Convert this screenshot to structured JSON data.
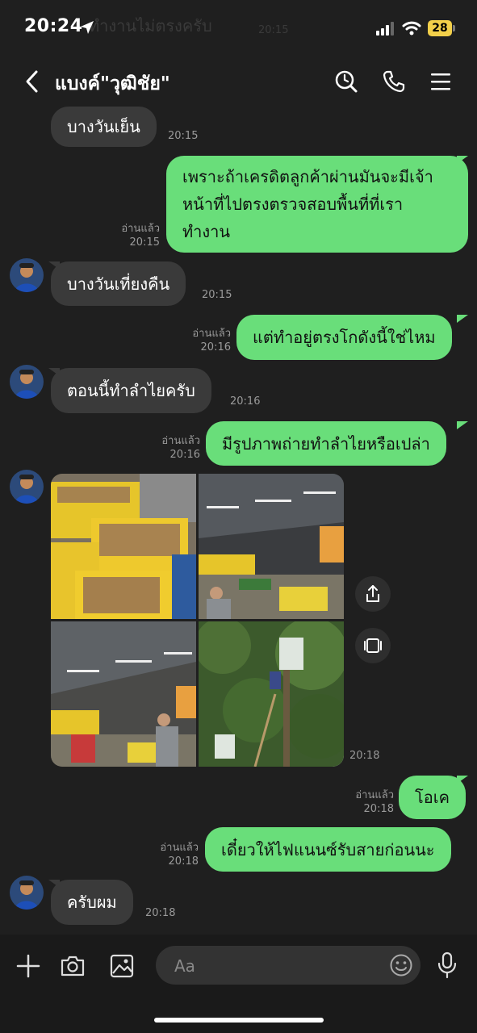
{
  "status_bar": {
    "time": "20:24",
    "battery": "28",
    "ghost_text": "ทำงานไม่ตรงครับ",
    "ghost_time": "20:15"
  },
  "header": {
    "title": "แบงค์\"วุฒิชัย\"",
    "icons": [
      "back-icon",
      "search-icon",
      "phone-icon",
      "menu-icon"
    ]
  },
  "messages": [
    {
      "side": "in",
      "text": "บางวันเย็น",
      "time": "20:15"
    },
    {
      "side": "out",
      "lines": [
        "เพราะถ้าเครดิตลูกค้าผ่านมันจะมีเจ้า",
        "หน้าที่ไปตรงตรวจสอบพื้นที่ที่เรา",
        "ทำงาน"
      ],
      "read": "อ่านแล้ว",
      "time": "20:15"
    },
    {
      "side": "in",
      "text": "บางวันเที่ยงคืน",
      "time": "20:15"
    },
    {
      "side": "out",
      "text": "แต่ทำอยู่ตรงโกดังนี้ใช่ไหม",
      "read": "อ่านแล้ว",
      "time": "20:16"
    },
    {
      "side": "in",
      "text": "ตอนนี้ทำลำไยครับ",
      "time": "20:16"
    },
    {
      "side": "out",
      "text": "มีรูปภาพถ่ายทำลำไยหรือเปล่า",
      "read": "อ่านแล้ว",
      "time": "20:16"
    },
    {
      "side": "in",
      "type": "photos",
      "count": 4,
      "time": "20:18"
    },
    {
      "side": "out",
      "text": "โอเค",
      "read": "อ่านแล้ว",
      "time": "20:18"
    },
    {
      "side": "out",
      "text": "เดี๋ยวให้ไฟแนนซ์รับสายก่อนนะ",
      "read": "อ่านแล้ว",
      "time": "20:18"
    },
    {
      "side": "in",
      "text": "ครับผม",
      "time": "20:18"
    }
  ],
  "photo_actions": [
    "share-icon",
    "slideshow-icon"
  ],
  "composer": {
    "placeholder": "Aa",
    "icons": [
      "plus-icon",
      "camera-icon",
      "image-icon",
      "emoji-icon",
      "mic-icon"
    ]
  },
  "colors": {
    "background": "#1f1f1f",
    "incoming_bubble": "#3a3a3a",
    "outgoing_bubble": "#69de7a",
    "battery": "#f3d04a"
  }
}
